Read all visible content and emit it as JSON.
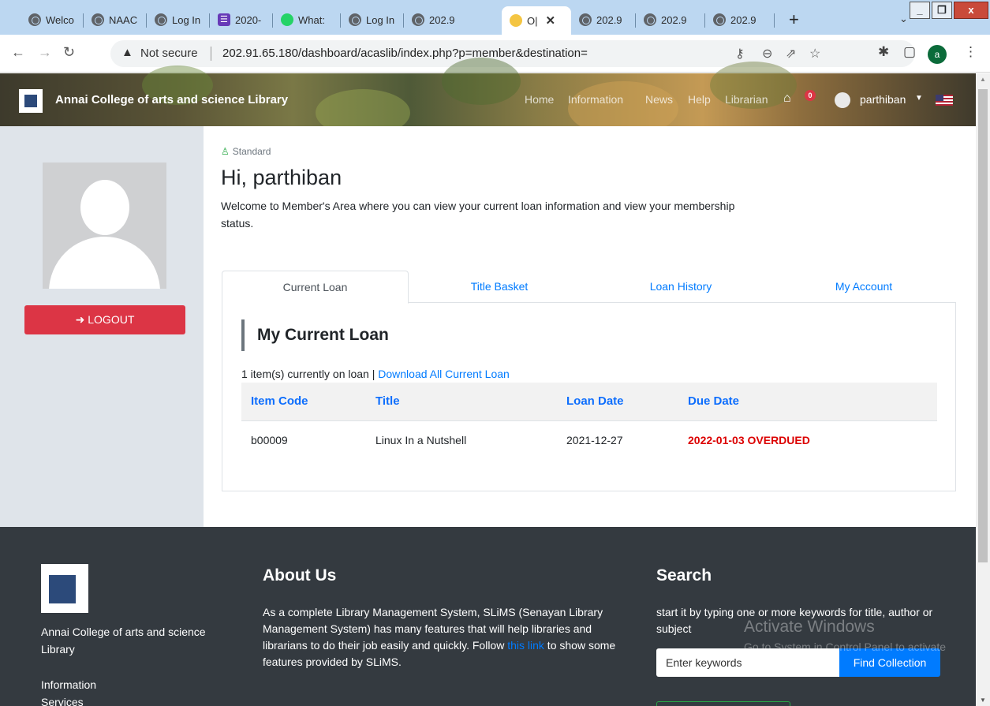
{
  "browser": {
    "tabs": [
      {
        "label": "Welco",
        "icon": "globe-icon"
      },
      {
        "label": "NAAC",
        "icon": "globe-icon"
      },
      {
        "label": "Log In",
        "icon": "globe-icon"
      },
      {
        "label": "2020-",
        "icon": "forms-icon"
      },
      {
        "label": "What:",
        "icon": "whatsapp-icon"
      },
      {
        "label": "Log In",
        "icon": "globe-icon"
      },
      {
        "label": "202.9",
        "icon": "globe-icon"
      },
      {
        "label": "O|",
        "icon": "emoji-icon"
      },
      {
        "label": "202.9",
        "icon": "globe-icon"
      },
      {
        "label": "202.9",
        "icon": "globe-icon"
      },
      {
        "label": "202.9",
        "icon": "globe-icon"
      }
    ],
    "not_secure": "Not secure",
    "url": "202.91.65.180/dashboard/acaslib/index.php?p=member&destination=",
    "profile_initial": "a"
  },
  "header": {
    "brand": "Annai College of arts and science Library",
    "nav": [
      "Home",
      "Information",
      "News",
      "Help",
      "Librarian"
    ],
    "basket_count": "0",
    "username": "parthiban"
  },
  "sidebar": {
    "logout_label": "LOGOUT"
  },
  "member": {
    "type": "Standard",
    "greeting": "Hi, parthiban",
    "welcome": "Welcome to Member's Area where you can view your current loan information and view your membership status."
  },
  "tabs": [
    "Current Loan",
    "Title Basket",
    "Loan History",
    "My Account"
  ],
  "loan": {
    "section_title": "My Current Loan",
    "count_text": "1 item(s) currently on loan |",
    "download_link": "Download All Current Loan",
    "columns": [
      "Item Code",
      "Title",
      "Loan Date",
      "Due Date"
    ],
    "rows": [
      {
        "item_code": "b00009",
        "title": "Linux In a Nutshell",
        "loan_date": "2021-12-27",
        "due_date": "2022-01-03 OVERDUED"
      }
    ]
  },
  "footer": {
    "library_name": "Annai College of arts and science Library",
    "links": [
      "Information",
      "Services"
    ],
    "about_heading": "About Us",
    "about_text_1": "As a complete Library Management System, SLiMS (Senayan Library Management System) has many features that will help libraries and librarians to do their job easily and quickly. Follow ",
    "about_link": "this link",
    "about_text_2": " to show some features provided by SLiMS.",
    "search_heading": "Search",
    "search_text": "start it by typing one or more keywords for title, author or subject",
    "search_placeholder": "Enter keywords",
    "search_button": "Find Collection"
  },
  "watermark": {
    "line1": "Activate Windows",
    "line2": "Go to System in Control Panel to activate Windows."
  }
}
